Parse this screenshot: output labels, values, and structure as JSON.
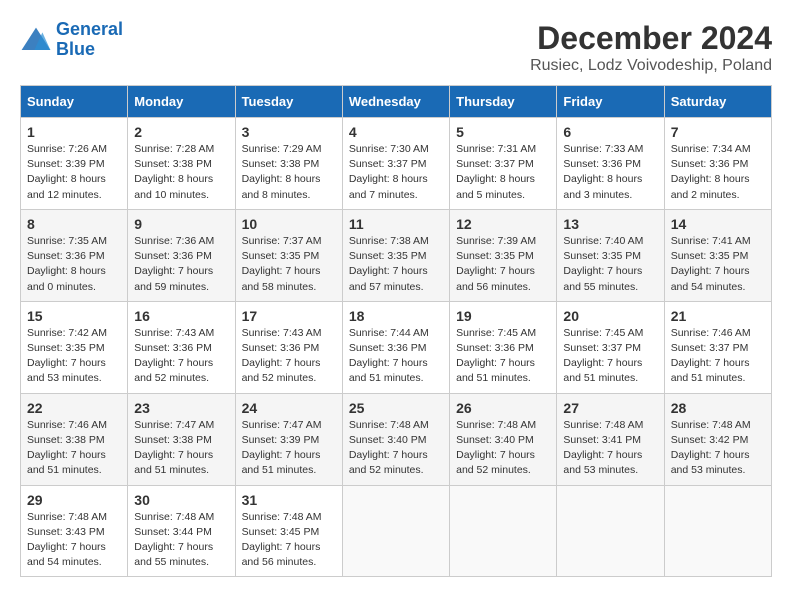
{
  "logo": {
    "line1": "General",
    "line2": "Blue"
  },
  "title": "December 2024",
  "subtitle": "Rusiec, Lodz Voivodeship, Poland",
  "days_of_week": [
    "Sunday",
    "Monday",
    "Tuesday",
    "Wednesday",
    "Thursday",
    "Friday",
    "Saturday"
  ],
  "weeks": [
    [
      {
        "day": "1",
        "info": "Sunrise: 7:26 AM\nSunset: 3:39 PM\nDaylight: 8 hours\nand 12 minutes."
      },
      {
        "day": "2",
        "info": "Sunrise: 7:28 AM\nSunset: 3:38 PM\nDaylight: 8 hours\nand 10 minutes."
      },
      {
        "day": "3",
        "info": "Sunrise: 7:29 AM\nSunset: 3:38 PM\nDaylight: 8 hours\nand 8 minutes."
      },
      {
        "day": "4",
        "info": "Sunrise: 7:30 AM\nSunset: 3:37 PM\nDaylight: 8 hours\nand 7 minutes."
      },
      {
        "day": "5",
        "info": "Sunrise: 7:31 AM\nSunset: 3:37 PM\nDaylight: 8 hours\nand 5 minutes."
      },
      {
        "day": "6",
        "info": "Sunrise: 7:33 AM\nSunset: 3:36 PM\nDaylight: 8 hours\nand 3 minutes."
      },
      {
        "day": "7",
        "info": "Sunrise: 7:34 AM\nSunset: 3:36 PM\nDaylight: 8 hours\nand 2 minutes."
      }
    ],
    [
      {
        "day": "8",
        "info": "Sunrise: 7:35 AM\nSunset: 3:36 PM\nDaylight: 8 hours\nand 0 minutes."
      },
      {
        "day": "9",
        "info": "Sunrise: 7:36 AM\nSunset: 3:36 PM\nDaylight: 7 hours\nand 59 minutes."
      },
      {
        "day": "10",
        "info": "Sunrise: 7:37 AM\nSunset: 3:35 PM\nDaylight: 7 hours\nand 58 minutes."
      },
      {
        "day": "11",
        "info": "Sunrise: 7:38 AM\nSunset: 3:35 PM\nDaylight: 7 hours\nand 57 minutes."
      },
      {
        "day": "12",
        "info": "Sunrise: 7:39 AM\nSunset: 3:35 PM\nDaylight: 7 hours\nand 56 minutes."
      },
      {
        "day": "13",
        "info": "Sunrise: 7:40 AM\nSunset: 3:35 PM\nDaylight: 7 hours\nand 55 minutes."
      },
      {
        "day": "14",
        "info": "Sunrise: 7:41 AM\nSunset: 3:35 PM\nDaylight: 7 hours\nand 54 minutes."
      }
    ],
    [
      {
        "day": "15",
        "info": "Sunrise: 7:42 AM\nSunset: 3:35 PM\nDaylight: 7 hours\nand 53 minutes."
      },
      {
        "day": "16",
        "info": "Sunrise: 7:43 AM\nSunset: 3:36 PM\nDaylight: 7 hours\nand 52 minutes."
      },
      {
        "day": "17",
        "info": "Sunrise: 7:43 AM\nSunset: 3:36 PM\nDaylight: 7 hours\nand 52 minutes."
      },
      {
        "day": "18",
        "info": "Sunrise: 7:44 AM\nSunset: 3:36 PM\nDaylight: 7 hours\nand 51 minutes."
      },
      {
        "day": "19",
        "info": "Sunrise: 7:45 AM\nSunset: 3:36 PM\nDaylight: 7 hours\nand 51 minutes."
      },
      {
        "day": "20",
        "info": "Sunrise: 7:45 AM\nSunset: 3:37 PM\nDaylight: 7 hours\nand 51 minutes."
      },
      {
        "day": "21",
        "info": "Sunrise: 7:46 AM\nSunset: 3:37 PM\nDaylight: 7 hours\nand 51 minutes."
      }
    ],
    [
      {
        "day": "22",
        "info": "Sunrise: 7:46 AM\nSunset: 3:38 PM\nDaylight: 7 hours\nand 51 minutes."
      },
      {
        "day": "23",
        "info": "Sunrise: 7:47 AM\nSunset: 3:38 PM\nDaylight: 7 hours\nand 51 minutes."
      },
      {
        "day": "24",
        "info": "Sunrise: 7:47 AM\nSunset: 3:39 PM\nDaylight: 7 hours\nand 51 minutes."
      },
      {
        "day": "25",
        "info": "Sunrise: 7:48 AM\nSunset: 3:40 PM\nDaylight: 7 hours\nand 52 minutes."
      },
      {
        "day": "26",
        "info": "Sunrise: 7:48 AM\nSunset: 3:40 PM\nDaylight: 7 hours\nand 52 minutes."
      },
      {
        "day": "27",
        "info": "Sunrise: 7:48 AM\nSunset: 3:41 PM\nDaylight: 7 hours\nand 53 minutes."
      },
      {
        "day": "28",
        "info": "Sunrise: 7:48 AM\nSunset: 3:42 PM\nDaylight: 7 hours\nand 53 minutes."
      }
    ],
    [
      {
        "day": "29",
        "info": "Sunrise: 7:48 AM\nSunset: 3:43 PM\nDaylight: 7 hours\nand 54 minutes."
      },
      {
        "day": "30",
        "info": "Sunrise: 7:48 AM\nSunset: 3:44 PM\nDaylight: 7 hours\nand 55 minutes."
      },
      {
        "day": "31",
        "info": "Sunrise: 7:48 AM\nSunset: 3:45 PM\nDaylight: 7 hours\nand 56 minutes."
      },
      null,
      null,
      null,
      null
    ]
  ]
}
